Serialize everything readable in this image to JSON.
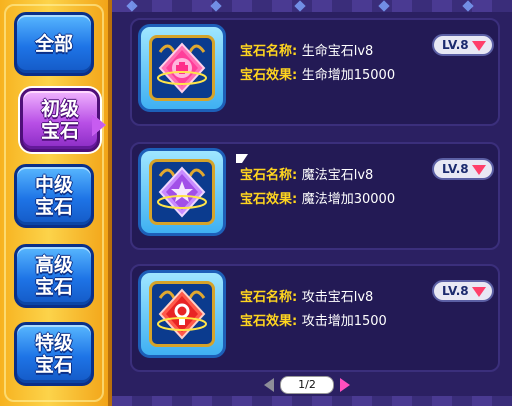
{
  "sidebar": {
    "items": [
      {
        "label": "全部",
        "active": false
      },
      {
        "label": "初级\n宝石",
        "active": true
      },
      {
        "label": "中级\n宝石",
        "active": false
      },
      {
        "label": "高级\n宝石",
        "active": false
      },
      {
        "label": "特级\n宝石",
        "active": false
      }
    ]
  },
  "gems": [
    {
      "name_label": "宝石名称:",
      "name": "生命宝石lv8",
      "effect_label": "宝石效果:",
      "effect": "生命增加15000",
      "level": "LV.8",
      "color": "#ff4fa6",
      "icon": "heart-cross-gem-icon"
    },
    {
      "name_label": "宝石名称:",
      "name": "魔法宝石lv8",
      "effect_label": "宝石效果:",
      "effect": "魔法增加30000",
      "level": "LV.8",
      "color": "#b66cff",
      "icon": "star-magic-gem-icon"
    },
    {
      "name_label": "宝石名称:",
      "name": "攻击宝石lv8",
      "effect_label": "宝石效果:",
      "effect": "攻击增加1500",
      "level": "LV.8",
      "color": "#ff3a3a",
      "icon": "attack-gem-icon"
    }
  ],
  "pager": {
    "text": "1/2"
  },
  "colors": {
    "label": "#ffd51f",
    "value": "#ffffff",
    "panel": "#231a55"
  }
}
